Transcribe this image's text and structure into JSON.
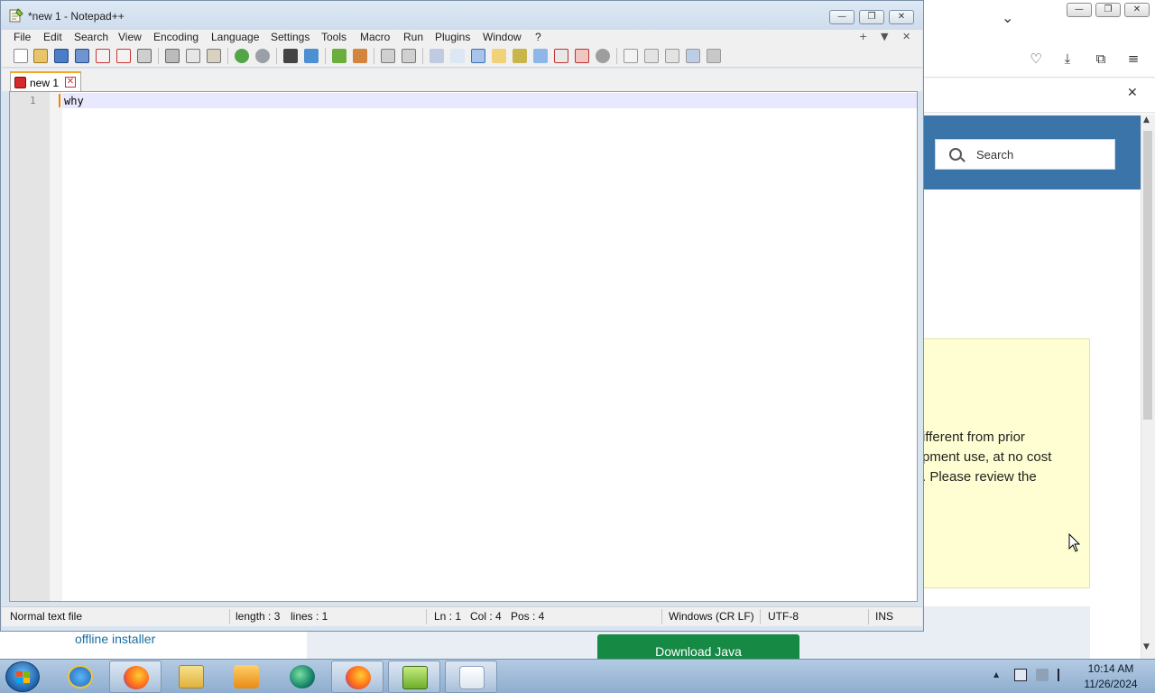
{
  "browser": {
    "search_placeholder": "Search",
    "notice_lines": [
      "ifferent from prior",
      "pment use, at no cost",
      ". Please review the"
    ],
    "offline_link": "offline installer",
    "download_button": "Download Java",
    "header_color": "#3a74a8",
    "notice_bg": "#fefed2"
  },
  "notepad": {
    "title": "*new 1 - Notepad++",
    "menu": [
      "File",
      "Edit",
      "Search",
      "View",
      "Encoding",
      "Language",
      "Settings",
      "Tools",
      "Macro",
      "Run",
      "Plugins",
      "Window",
      "?"
    ],
    "menu_right": [
      "+",
      "▼",
      "✕"
    ],
    "tab_label": "new 1",
    "line_number": "1",
    "code_line": "why",
    "status": {
      "file_type": "Normal text file",
      "length": "length : 3",
      "lines": "lines : 1",
      "ln": "Ln : 1",
      "col": "Col : 4",
      "pos": "Pos : 4",
      "eol": "Windows (CR LF)",
      "encoding": "UTF-8",
      "mode": "INS"
    },
    "accent": "#f5a623"
  },
  "taskbar": {
    "apps": [
      "internet-explorer",
      "firefox",
      "file-explorer",
      "media-player",
      "app-green",
      "firefox",
      "notepad-plus-plus",
      "java"
    ],
    "time": "10:14 AM",
    "date": "11/26/2024"
  }
}
